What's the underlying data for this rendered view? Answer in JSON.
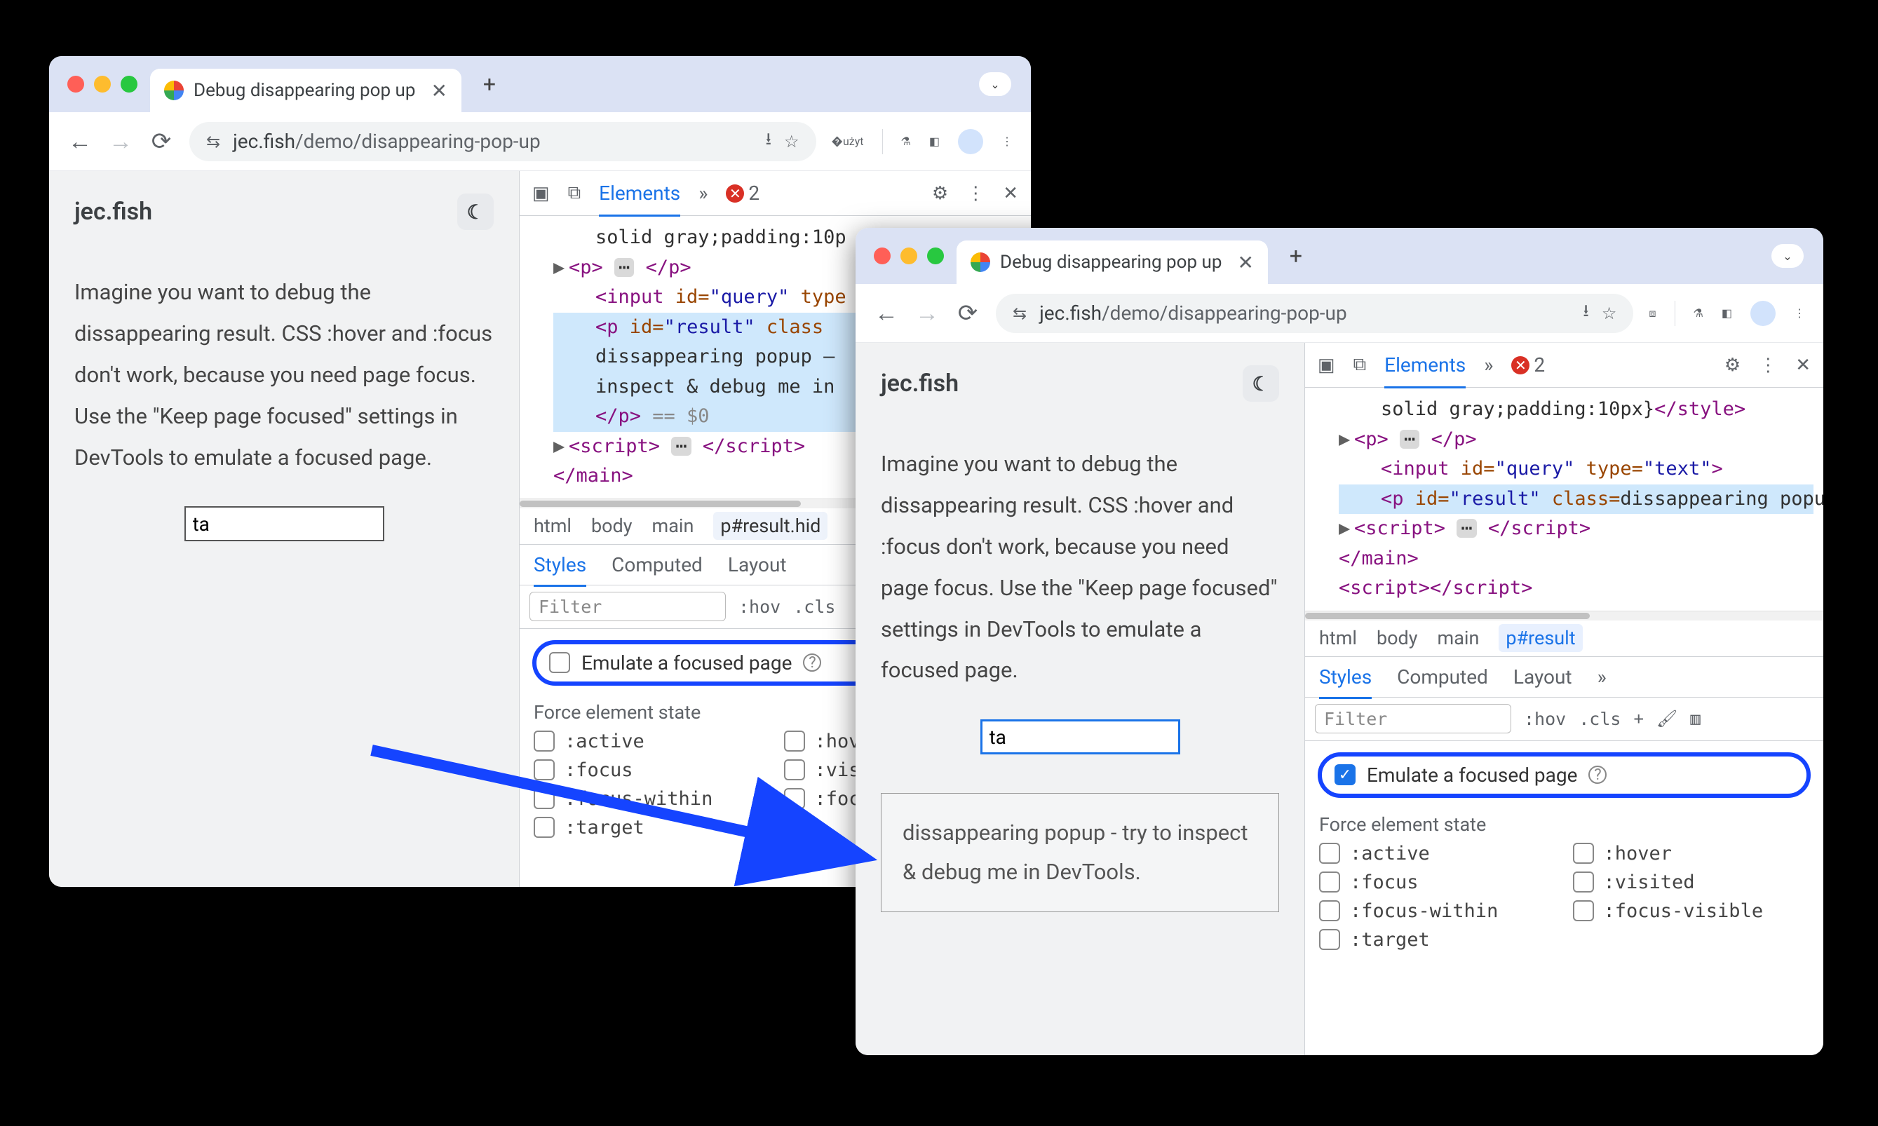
{
  "tab_title": "Debug disappearing pop up",
  "url_domain": "jec.fish",
  "url_path": "/demo/disappearing-pop-up",
  "page_brand": "jec.fish",
  "page_paragraph": "Imagine you want to debug the dissappearing result. CSS :hover and :focus don't work, because you need page focus. Use the \"Keep page focused\" settings in DevTools to emulate a focused page.",
  "input_value": "ta",
  "popup_text": "dissappearing popup - try to inspect & debug me in DevTools.",
  "devtools": {
    "tab_elements": "Elements",
    "error_count": "2",
    "filter_placeholder": "Filter",
    "hov_label": ":hov",
    "cls_label": ".cls",
    "crumbs": {
      "html": "html",
      "body": "body",
      "main": "main",
      "result_hidden": "p#result.hid",
      "result": "p#result"
    },
    "style_tabs": {
      "styles": "Styles",
      "computed": "Computed",
      "layout": "Layout"
    },
    "emulate_label": "Emulate a focused page",
    "force_header": "Force element state",
    "states": {
      "active": ":active",
      "hover": ":hover",
      "focus": ":focus",
      "visited": ":visi",
      "visited_full": ":visited",
      "focus_within": ":focus-within",
      "focus_visible": ":focu",
      "focus_visible_full": ":focus-visible",
      "target": ":target"
    },
    "dom": {
      "style_line": "solid gray;padding:10p",
      "style_line2": "solid gray;padding:10px}",
      "p_open": "<p>",
      "p_close": "</p>",
      "input_open": "<input ",
      "input_id": "id=",
      "input_id_v": "\"query\"",
      "input_type": "type",
      "input_type_full": "type=",
      "input_type_v": "\"text\"",
      "input_end": ">",
      "presult_open": "<p ",
      "presult_id": "id=",
      "presult_id_v": "\"result\"",
      "presult_class": "class=",
      "presult_class_end": "class",
      "resultline1": "dissappearing popup –",
      "resultline2": "inspect & debug me in",
      "resultfull": "dissappearing popup – try to inspect & debug me in DevTools.",
      "p_close2": "</p>",
      "eq0": " == $0",
      "script_open": "<script>",
      "script_close": "</script>",
      "main_close": "</main>",
      "style_close": "</style>"
    }
  }
}
